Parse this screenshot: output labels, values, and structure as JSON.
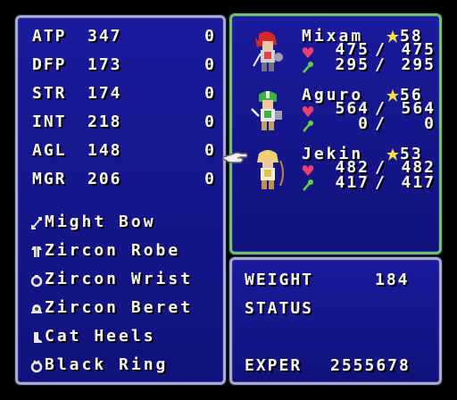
{
  "stats": [
    {
      "name": "ATP",
      "value": "347",
      "bonus": "0"
    },
    {
      "name": "DFP",
      "value": "173",
      "bonus": "0"
    },
    {
      "name": "STR",
      "value": "174",
      "bonus": "0"
    },
    {
      "name": "INT",
      "value": "218",
      "bonus": "0"
    },
    {
      "name": "AGL",
      "value": "148",
      "bonus": "0"
    },
    {
      "name": "MGR",
      "value": "206",
      "bonus": "0"
    }
  ],
  "equipment": [
    {
      "name": "Might Bow",
      "icon": "bow-icon"
    },
    {
      "name": "Zircon Robe",
      "icon": "robe-icon"
    },
    {
      "name": "Zircon Wrist",
      "icon": "ring-icon"
    },
    {
      "name": "Zircon Beret",
      "icon": "helmet-icon"
    },
    {
      "name": "Cat Heels",
      "icon": "boots-icon"
    },
    {
      "name": "Black Ring",
      "icon": "ring-icon"
    }
  ],
  "party": [
    {
      "name": "Mixam",
      "level": "58",
      "hp": "475",
      "hp_max": "475",
      "mp": "295",
      "mp_max": "295",
      "sep": "/"
    },
    {
      "name": "Aguro",
      "level": "56",
      "hp": "564",
      "hp_max": "564",
      "mp": "0",
      "mp_max": "0",
      "sep": "/"
    },
    {
      "name": "Jekin",
      "level": "53",
      "hp": "482",
      "hp_max": "482",
      "mp": "417",
      "mp_max": "417",
      "sep": "/"
    }
  ],
  "info": {
    "weight_label": "WEIGHT",
    "weight_value": "184",
    "status_label": "STATUS",
    "exper_label": "EXPER",
    "exper_value": "2555678"
  },
  "colors": {
    "panel": "#1a1a9c",
    "border": "#a8a8c8",
    "selected_border": "#6cc06c",
    "heart": "#f04070",
    "star": "#f8e040",
    "mp_icon": "#60d040"
  }
}
